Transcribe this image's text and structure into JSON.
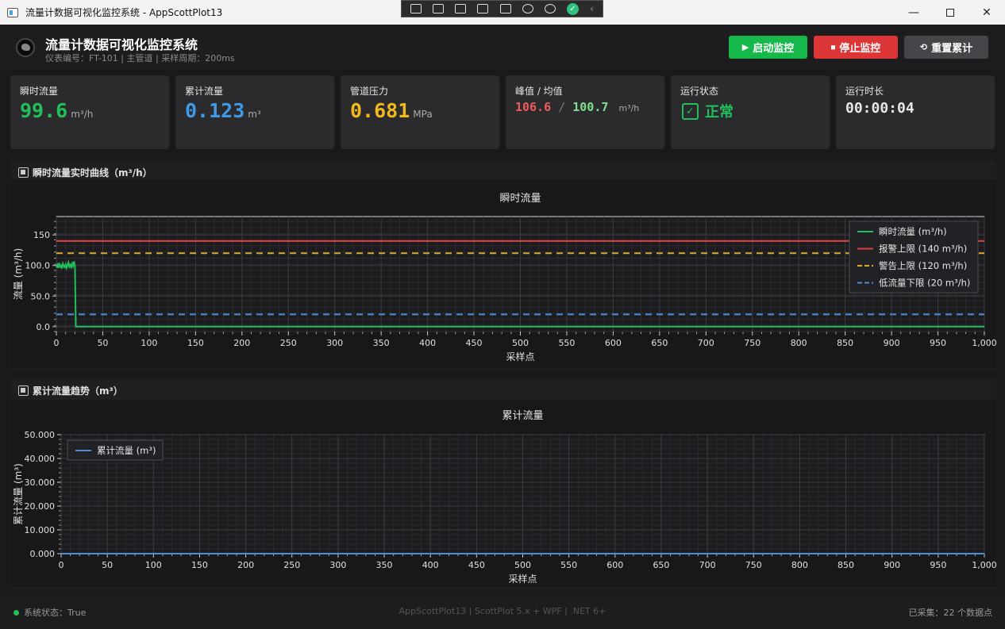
{
  "window": {
    "title": "流量计数据可视化监控系统 - AppScottPlot13"
  },
  "header": {
    "title": "流量计数据可视化监控系统",
    "subtitle": "仪表编号：FT-101 | 主管道 | 采样周期：200ms",
    "start_label": "启动监控",
    "stop_label": "停止监控",
    "reset_label": "重置累计"
  },
  "cards": {
    "flow": {
      "label": "瞬时流量",
      "value": "99.6",
      "unit": "m³/h",
      "color": "#21c05a"
    },
    "total": {
      "label": "累计流量",
      "value": "0.123",
      "unit": "m³",
      "color": "#3f9be8"
    },
    "pressure": {
      "label": "管道压力",
      "value": "0.681",
      "unit": "MPa",
      "color": "#f2b91c"
    },
    "peak": {
      "label": "峰值 / 均值",
      "peak": "106.6",
      "sep": "/",
      "avg": "100.7",
      "unit": "m³/h",
      "peak_color": "#ef5b5b",
      "avg_color": "#7fe08d"
    },
    "status": {
      "label": "运行状态",
      "value": "正常"
    },
    "runtime": {
      "label": "运行时长",
      "value": "00:00:04"
    }
  },
  "panels": {
    "flow_title": "瞬时流量实时曲线（m³/h）",
    "total_title": "累计流量趋势（m³）"
  },
  "chart_data": [
    {
      "type": "line",
      "title": "瞬时流量",
      "xlabel": "采样点",
      "ylabel": "流量 (m³/h)",
      "xlim": [
        0,
        1000
      ],
      "ylim": [
        -8,
        180
      ],
      "xticks": [
        0,
        50,
        100,
        150,
        200,
        250,
        300,
        350,
        400,
        450,
        500,
        550,
        600,
        650,
        700,
        750,
        800,
        850,
        900,
        950,
        1000
      ],
      "xtick_labels": [
        "0",
        "50",
        "100",
        "150",
        "200",
        "250",
        "300",
        "350",
        "400",
        "450",
        "500",
        "550",
        "600",
        "650",
        "700",
        "750",
        "800",
        "850",
        "900",
        "950",
        "1,000"
      ],
      "yticks": [
        0,
        50,
        100,
        150
      ],
      "ytick_labels": [
        "0.0",
        "50.0",
        "100.0",
        "150"
      ],
      "grid": true,
      "legend": "top-right",
      "series": [
        {
          "name": "瞬时流量 (m³/h)",
          "color": "#21c05a",
          "x": [
            0,
            1,
            2,
            3,
            4,
            5,
            6,
            7,
            8,
            9,
            10,
            11,
            12,
            13,
            14,
            15,
            16,
            17,
            18,
            19,
            20,
            21,
            22,
            1000
          ],
          "y": [
            97,
            101,
            96,
            104,
            98,
            100,
            95,
            103,
            99,
            97,
            102,
            96,
            100,
            105,
            98,
            101,
            97,
            103,
            99,
            106.6,
            99.6,
            0,
            0,
            0
          ]
        }
      ],
      "reference_lines": [
        {
          "name": "报警上限 (140 m³/h)",
          "value": 140,
          "color": "#d9403f",
          "dash": false
        },
        {
          "name": "警告上限 (120 m³/h)",
          "value": 120,
          "color": "#e0a92a",
          "dash": true
        },
        {
          "name": "低流量下限 (20 m³/h)",
          "value": 20,
          "color": "#4a8fd8",
          "dash": true
        }
      ]
    },
    {
      "type": "line",
      "title": "累计流量",
      "xlabel": "采样点",
      "ylabel": "累计流量 (m³)",
      "xlim": [
        0,
        1000
      ],
      "ylim": [
        0,
        50
      ],
      "xticks": [
        0,
        50,
        100,
        150,
        200,
        250,
        300,
        350,
        400,
        450,
        500,
        550,
        600,
        650,
        700,
        750,
        800,
        850,
        900,
        950,
        1000
      ],
      "xtick_labels": [
        "0",
        "50",
        "100",
        "150",
        "200",
        "250",
        "300",
        "350",
        "400",
        "450",
        "500",
        "550",
        "600",
        "650",
        "700",
        "750",
        "800",
        "850",
        "900",
        "950",
        "1,000"
      ],
      "yticks": [
        0,
        10,
        20,
        30,
        40,
        50
      ],
      "ytick_labels": [
        "0.000",
        "10.000",
        "20.000",
        "30.000",
        "40.000",
        "50.000"
      ],
      "grid": true,
      "legend": "top-left",
      "series": [
        {
          "name": "累计流量 (m³)",
          "color": "#4a8fd8",
          "x": [
            0,
            1000
          ],
          "y": [
            0,
            0
          ]
        }
      ]
    }
  ],
  "statusbar": {
    "left": "系统状态：True",
    "center": "AppScottPlot13 | ScottPlot 5.x + WPF | .NET 6+",
    "right": "已采集：22 个数据点"
  }
}
